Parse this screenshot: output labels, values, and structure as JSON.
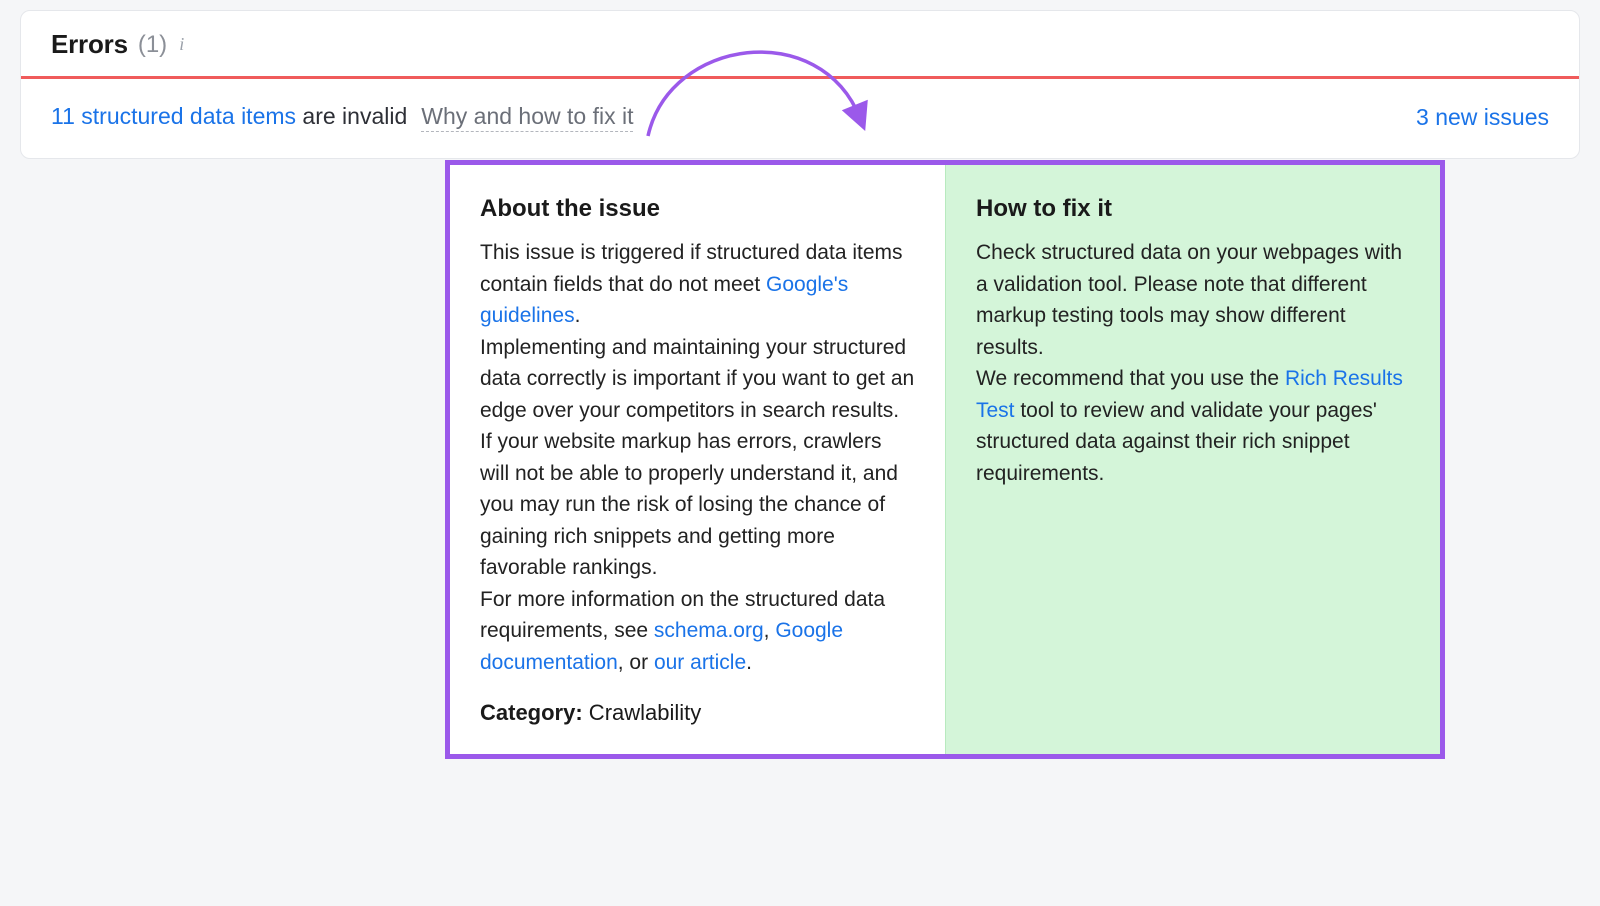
{
  "header": {
    "title": "Errors",
    "count_label": "(1)",
    "info_tooltip": "i"
  },
  "issue": {
    "link_text": "11 structured data items",
    "suffix_text": " are invalid",
    "why_fix_label": "Why and how to fix it",
    "new_issues_label": "3 new issues"
  },
  "popup": {
    "about": {
      "heading": "About the issue",
      "p1_pre": "This issue is triggered if structured data items contain fields that do not meet ",
      "p1_link": "Google's guidelines",
      "p1_post": ".",
      "p2": "Implementing and maintaining your structured data correctly is important if you want to get an edge over your competitors in search results.",
      "p3": "If your website markup has errors, crawlers will not be able to properly understand it, and you may run the risk of losing the chance of gaining rich snippets and getting more favorable rankings.",
      "p4_pre": "For more information on the structured data requirements, see ",
      "p4_link1": "schema.org",
      "p4_mid1": ", ",
      "p4_link2": "Google documentation",
      "p4_mid2": ", or ",
      "p4_link3": "our article",
      "p4_post": ".",
      "category_label": "Category:",
      "category_value": " Crawlability"
    },
    "fix": {
      "heading": "How to fix it",
      "p1": "Check structured data on your webpages with a validation tool. Please note that different markup testing tools may show different results.",
      "p2_pre": "We recommend that you use the ",
      "p2_link": "Rich Results Test",
      "p2_post": " tool to review and validate your pages' structured data against their rich snippet requirements."
    }
  },
  "colors": {
    "purple": "#9b59ea",
    "error_red": "#f05b5b",
    "link_blue": "#1a73e8",
    "fix_bg": "#d4f5d9"
  }
}
